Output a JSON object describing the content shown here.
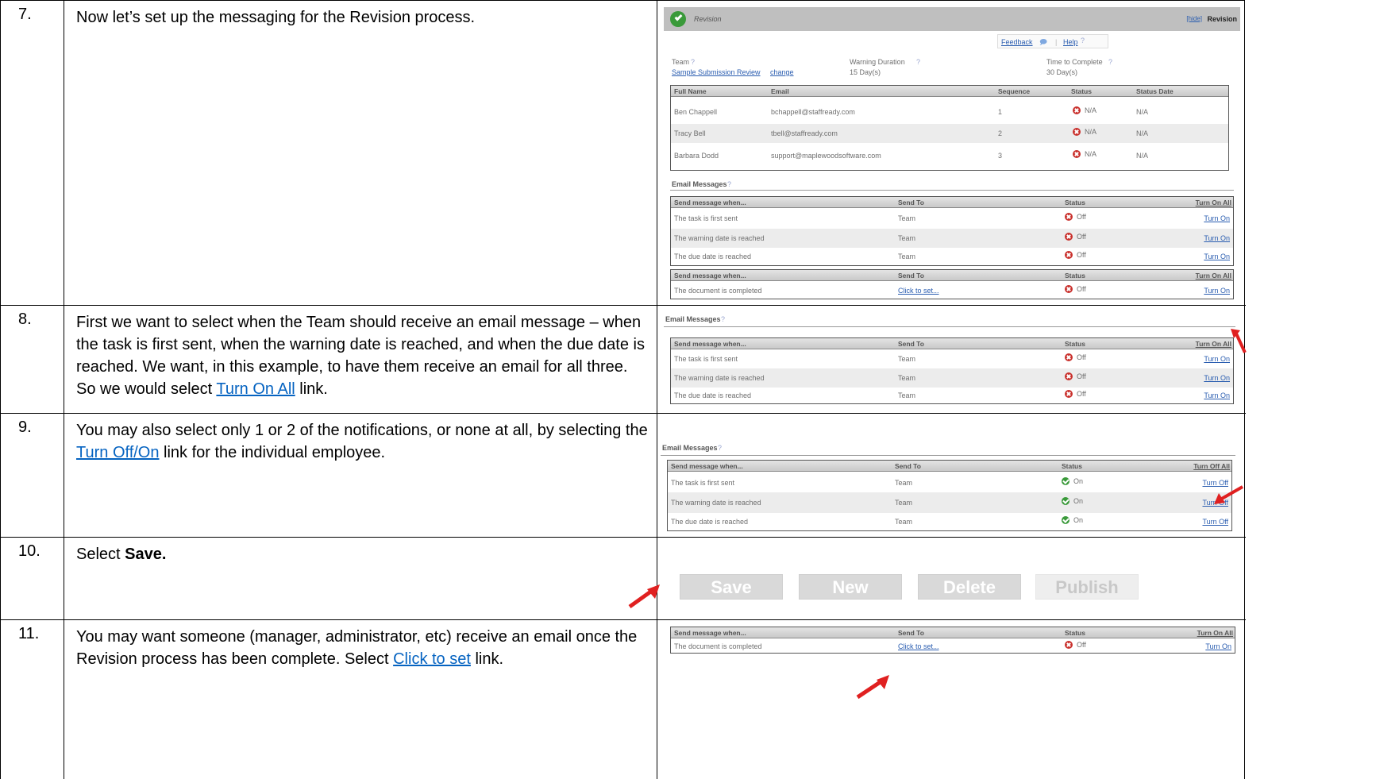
{
  "steps": [
    {
      "num": "7.",
      "text": "Now let’s set up the messaging for the Revision process."
    },
    {
      "num": "8.",
      "text_pre": "First we want to select when the Team should receive an email message – when the task is first sent, when the warning date is reached, and when the due date is reached.  We want, in this example, to have them receive an email for all three.  So we would select ",
      "link": "Turn On All",
      "text_post": " link."
    },
    {
      "num": "9.",
      "text_pre": "You may also select only 1 or 2 of the notifications, or none at all, by selecting the ",
      "link": "Turn Off/On",
      "text_post": " link for the individual employee."
    },
    {
      "num": "10.",
      "text_pre": "Select ",
      "bold": "Save."
    },
    {
      "num": "11.",
      "text_pre": "You may want someone (manager, administrator, etc) receive an email once the Revision process has been complete.  Select ",
      "link": "Click to set",
      "text_post": " link."
    }
  ],
  "revision": {
    "title": "Revision",
    "hide_link": "[hide]",
    "header_right": "Revision",
    "feedback": "Feedback",
    "help": "Help",
    "team_label": "Team",
    "team_value": "Sample Submission Review",
    "change": "change",
    "warning_label": "Warning Duration",
    "warning_value": "15 Day(s)",
    "time_label": "Time to Complete",
    "time_value": "30 Day(s)",
    "members_headers": [
      "Full Name",
      "Email",
      "Sequence",
      "Status",
      "Status Date"
    ],
    "members": [
      {
        "name": "Ben Chappell",
        "email": "bchappell@staffready.com",
        "seq": "1",
        "status": "N/A",
        "date": "N/A"
      },
      {
        "name": "Tracy Bell",
        "email": "tbell@staffready.com",
        "seq": "2",
        "status": "N/A",
        "date": "N/A"
      },
      {
        "name": "Barbara Dodd",
        "email": "support@maplewoodsoftware.com",
        "seq": "3",
        "status": "N/A",
        "date": "N/A"
      }
    ],
    "email_messages_title": "Email Messages",
    "msg_headers": [
      "Send message when...",
      "Send To",
      "Status",
      "Turn On All"
    ],
    "messages": [
      {
        "when": "The task is first sent",
        "to": "Team",
        "status": "Off",
        "action": "Turn On"
      },
      {
        "when": "The warning date is reached",
        "to": "Team",
        "status": "Off",
        "action": "Turn On"
      },
      {
        "when": "The due date is reached",
        "to": "Team",
        "status": "Off",
        "action": "Turn On"
      }
    ],
    "completed_row": {
      "when": "The document is completed",
      "to": "Click to set...",
      "status": "Off",
      "action": "Turn On"
    }
  },
  "messages_on": {
    "title": "Email Messages",
    "headers": [
      "Send message when...",
      "Send To",
      "Status",
      "Turn Off All"
    ],
    "rows": [
      {
        "when": "The task is first sent",
        "to": "Team",
        "status": "On",
        "action": "Turn Off"
      },
      {
        "when": "The warning date is reached",
        "to": "Team",
        "status": "On",
        "action": "Turn Off"
      },
      {
        "when": "The due date is reached",
        "to": "Team",
        "status": "On",
        "action": "Turn Off"
      }
    ]
  },
  "buttons": {
    "save": "Save",
    "new": "New",
    "delete": "Delete",
    "publish": "Publish"
  },
  "colors": {
    "link": "#0563c1",
    "arrow": "#e02020",
    "off": "#c9302c",
    "on": "#3a9a3a"
  }
}
